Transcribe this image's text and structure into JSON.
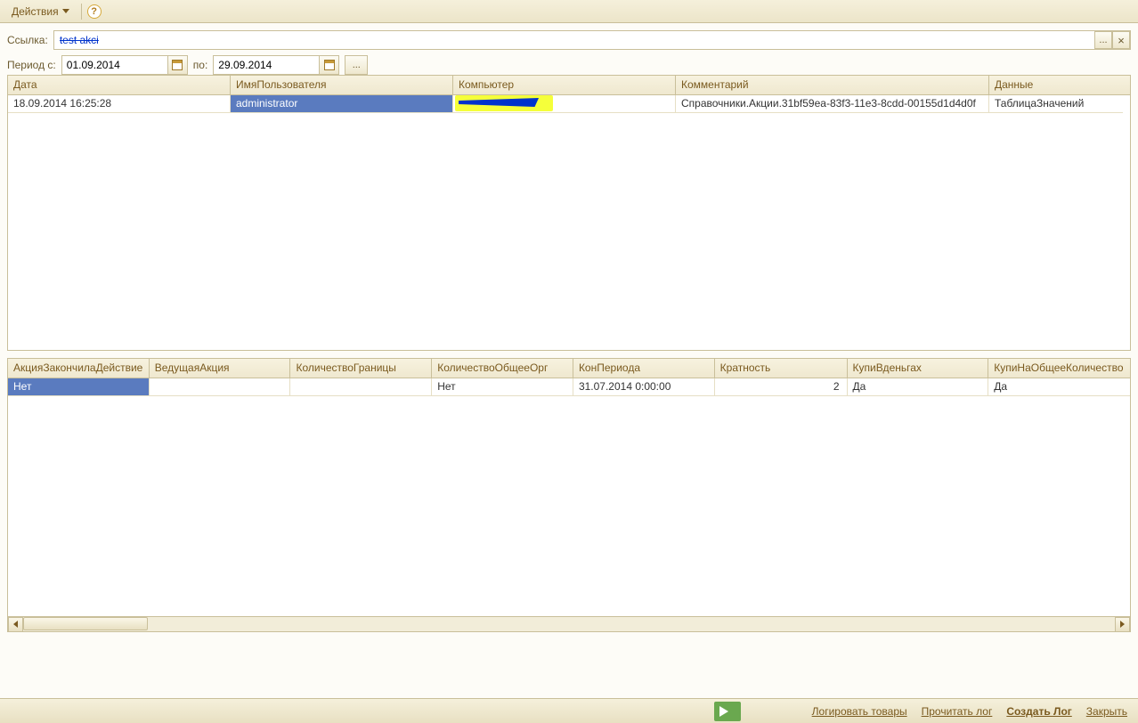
{
  "toolbar": {
    "actions_label": "Действия"
  },
  "link": {
    "label": "Ссылка:",
    "value": "test akci",
    "more": "...",
    "clear": "×"
  },
  "period": {
    "from_label": "Период с:",
    "from_value": "01.09.2014",
    "to_label": "по:",
    "to_value": "29.09.2014",
    "more": "..."
  },
  "grid1": {
    "headers": [
      "Дата",
      "ИмяПользователя",
      "Компьютер",
      "Комментарий",
      "Данные"
    ],
    "rows": [
      {
        "date": "18.09.2014 16:25:28",
        "user": "administrator",
        "computer": "",
        "comment": "Справочники.Акции.31bf59ea-83f3-11e3-8cdd-00155d1d4d0f",
        "data": "ТаблицаЗначений"
      }
    ]
  },
  "grid2": {
    "headers": [
      "АкцияЗакончилаДействие",
      "ВедущаяАкция",
      "КоличествоГраницы",
      "КоличествоОбщееОрг",
      "КонПериода",
      "Кратность",
      "КупиВденьгах",
      "КупиНаОбщееКоличество"
    ],
    "rows": [
      {
        "c0": "Нет",
        "c1": "",
        "c2": "",
        "c3": "Нет",
        "c4": "31.07.2014 0:00:00",
        "c5": "2",
        "c6": "Да",
        "c7": "Да"
      }
    ]
  },
  "footer": {
    "log_goods": "Логировать товары",
    "read_log": "Прочитать лог",
    "create_log": "Создать Лог",
    "close": "Закрыть"
  }
}
